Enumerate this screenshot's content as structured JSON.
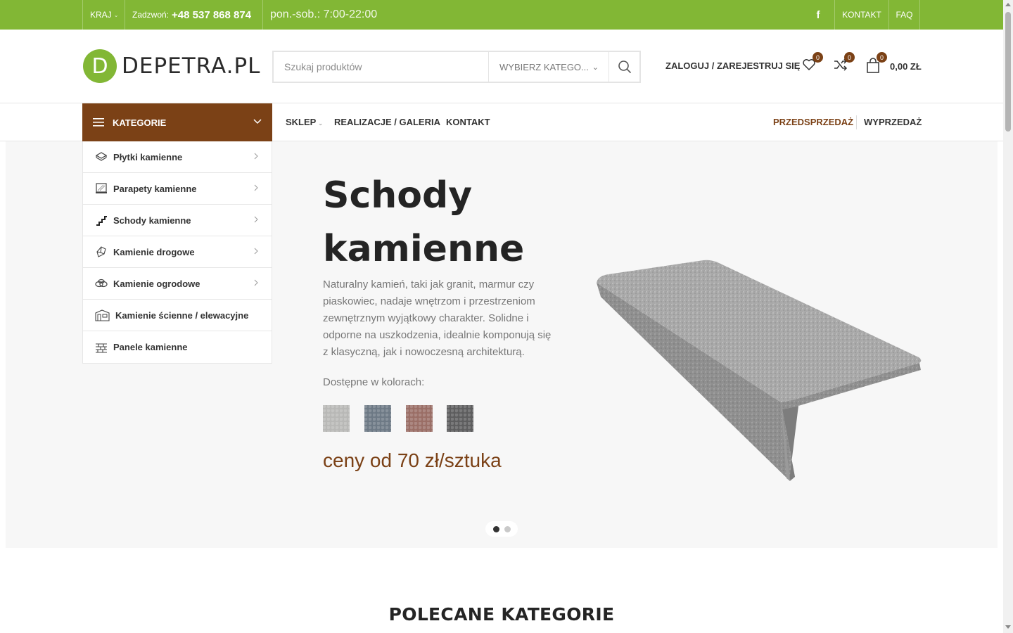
{
  "topbar": {
    "country": "KRAJ",
    "phone_label": "Zadzwoń:",
    "phone": "+48 537 868 874",
    "hours": "pon.-sob.:  7:00-22:00",
    "facebook_glyph": "f",
    "links": [
      "KONTAKT",
      "FAQ"
    ]
  },
  "header": {
    "logo_letter": "D",
    "logo_text": "DEPETRA.PL",
    "search_placeholder": "Szukaj produktów",
    "search_category": "WYBIERZ KATEGO...",
    "login": "ZALOGUJ / ZAREJESTRUJ SIĘ",
    "wishlist_count": "0",
    "compare_count": "0",
    "cart_count": "0",
    "cart_total": "0,00 ZŁ"
  },
  "nav": {
    "categories_label": "KATEGORIE",
    "links": [
      "SKLEP",
      "REALIZACJE / GALERIA",
      "KONTAKT"
    ],
    "right_links": [
      "PRZEDSPRZEDAŻ",
      "WYPRZEDAŻ"
    ],
    "accent_color": "#7b4116",
    "brand_green": "#82b735"
  },
  "categories": [
    {
      "label": "Płytki kamienne",
      "icon": "tiles-icon"
    },
    {
      "label": "Parapety kamienne",
      "icon": "windowsill-icon"
    },
    {
      "label": "Schody kamienne",
      "icon": "stairs-icon"
    },
    {
      "label": "Kamienie drogowe",
      "icon": "curb-stone-icon"
    },
    {
      "label": "Kamienie ogrodowe",
      "icon": "garden-stones-icon"
    },
    {
      "label": "Kamienie ścienne / elewacyjne",
      "icon": "facade-icon"
    },
    {
      "label": "Panele kamienne",
      "icon": "panels-icon"
    }
  ],
  "hero": {
    "title": "Schody kamienne",
    "description": "Naturalny kamień, taki jak granit, marmur czy piaskowiec, nadaje wnętrzom i przestrzeniom zewnętrznym wyjątkowy charakter. Solidne i odporne na uszkodzenia, idealnie komponują się z klasyczną, jak i nowoczesną architekturą.",
    "colors_label": "Dostępne w kolorach:",
    "swatch_colors": [
      "#b8b8b6",
      "#6d7985",
      "#9a6e66",
      "#5d5d5e"
    ],
    "price": "ceny od 70 zł/sztuka",
    "slides": 2,
    "active_slide": 1
  },
  "section": {
    "title": "POLECANE KATEGORIE"
  }
}
